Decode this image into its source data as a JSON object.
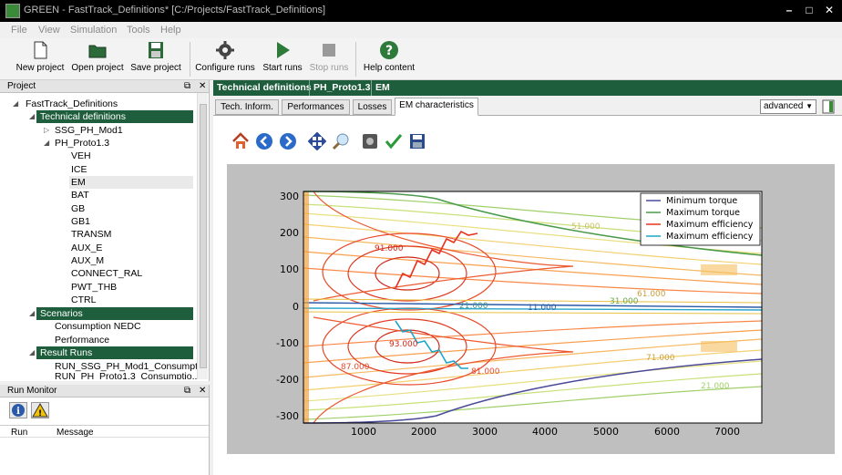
{
  "window": {
    "title": "GREEN - FastTrack_Definitions* [C:/Projects/FastTrack_Definitions]"
  },
  "menu": [
    "File",
    "View",
    "Simulation",
    "Tools",
    "Help"
  ],
  "toolbar": {
    "new_project": "New project",
    "open_project": "Open project",
    "save_project": "Save project",
    "configure_runs": "Configure runs",
    "start_runs": "Start runs",
    "stop_runs": "Stop runs",
    "help_content": "Help content"
  },
  "project_panel": {
    "title": "Project",
    "root": "FastTrack_Definitions",
    "technical_definitions": "Technical definitions",
    "ssg": "SSG_PH_Mod1",
    "ph": "PH_Proto1.3",
    "components": [
      "VEH",
      "ICE",
      "EM",
      "BAT",
      "GB",
      "GB1",
      "TRANSM",
      "AUX_E",
      "AUX_M",
      "CONNECT_RAL",
      "PWT_THB",
      "CTRL"
    ],
    "scenarios": "Scenarios",
    "scenario_items": [
      "Consumption NEDC",
      "Performance"
    ],
    "result_runs": "Result Runs",
    "result_items": [
      "RUN_SSG_PH_Mod1_Consumpt...",
      "RUN_PH_Proto1.3_Consumptio..."
    ]
  },
  "run_monitor": {
    "title": "Run Monitor",
    "col_run": "Run",
    "col_message": "Message"
  },
  "breadcrumb": [
    "Technical definitions",
    "PH_Proto1.3",
    "EM"
  ],
  "tabs": [
    "Tech. Inform.",
    "Performances",
    "Losses",
    "EM characteristics"
  ],
  "mode_select": "advanced",
  "chart_data": {
    "type": "line",
    "title": "",
    "xlabel": "",
    "ylabel": "",
    "xlim": [
      0,
      7600
    ],
    "ylim": [
      -320,
      320
    ],
    "xticks": [
      "1000",
      "2000",
      "3000",
      "4000",
      "5000",
      "6000",
      "7000"
    ],
    "yticks": [
      "300",
      "200",
      "100",
      "0",
      "-100",
      "-200",
      "-300"
    ],
    "legend": "top-right",
    "series": [
      {
        "name": "Minimum torque",
        "color": "#4a4a9a"
      },
      {
        "name": "Maximum torque",
        "color": "#4a9a4a"
      },
      {
        "name": "Maximum efficiency",
        "color": "#e8321e"
      },
      {
        "name": "Maximum efficiency",
        "color": "#1ea5c8"
      }
    ],
    "contour_labels": [
      "91.000",
      "93.000",
      "87.000",
      "81.000",
      "51.000",
      "11.000",
      "21.000",
      "31.000",
      "61.000",
      "71.000",
      "21.000"
    ]
  }
}
